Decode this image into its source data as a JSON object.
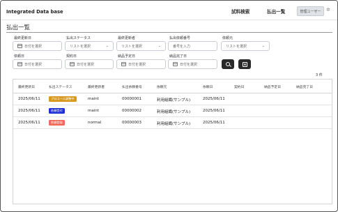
{
  "header": {
    "app_title": "Integrated Data base",
    "nav": {
      "search": "試料検索",
      "list": "払出一覧"
    },
    "user_button": "管理ユーザー"
  },
  "page_title": "払出一覧",
  "filters": {
    "last_updated": {
      "label": "最終更新日",
      "placeholder": "日付を選択"
    },
    "status": {
      "label": "払出ステータス",
      "placeholder": "リストを選択"
    },
    "last_updater": {
      "label": "最終更新者",
      "placeholder": "リストを選択"
    },
    "dispatch_no": {
      "label": "払出依頼番号",
      "placeholder": "番号を入力"
    },
    "requester": {
      "label": "依頼元",
      "placeholder": "リストを選択"
    },
    "request_date": {
      "label": "依頼日",
      "placeholder": "日付を選択"
    },
    "contract_date": {
      "label": "契約日",
      "placeholder": "日付を選択"
    },
    "planned_delivery": {
      "label": "納品予定日",
      "placeholder": "日付を選択"
    },
    "delivery_complete": {
      "label": "納品完了日",
      "placeholder": "日付を選択"
    }
  },
  "result_count": "3 件",
  "table": {
    "columns": [
      "最終更新日",
      "払出ステータス",
      "最終更新者",
      "払出依頼番号",
      "依頼元",
      "依頼日",
      "契約日",
      "納品予定日",
      "納品完了日"
    ],
    "rows": [
      {
        "updated": "2025/06/11",
        "status": "プロコール調整中",
        "status_color": "#d89a1a",
        "updater": "maint",
        "number": "00000001",
        "requester": "利用組織(サンプル)",
        "request_date": "2025/06/11",
        "contract_date": "",
        "planned_date": "",
        "completed_date": ""
      },
      {
        "updated": "2025/06/11",
        "status": "依頼受付",
        "status_color": "#1f2fd4",
        "updater": "maint",
        "number": "00000002",
        "requester": "利用組織(サンプル)",
        "request_date": "2025/06/11",
        "contract_date": "",
        "planned_date": "",
        "completed_date": ""
      },
      {
        "updated": "2025/06/11",
        "status": "依頼登録",
        "status_color": "#f06a5c",
        "updater": "normal",
        "number": "00000003",
        "requester": "利用組織(サンプル)",
        "request_date": "2025/06/11",
        "contract_date": "",
        "planned_date": "",
        "completed_date": ""
      }
    ]
  },
  "icons": {
    "search": "search-icon",
    "clear": "clear-icon",
    "settings": "gear-icon",
    "calendar": "calendar-icon",
    "dropdown": "chevron-down-icon"
  },
  "colors": {
    "accent_dark": "#2a2a2a",
    "status_pending": "#d89a1a",
    "status_accepted": "#1f2fd4",
    "status_registered": "#f06a5c"
  }
}
